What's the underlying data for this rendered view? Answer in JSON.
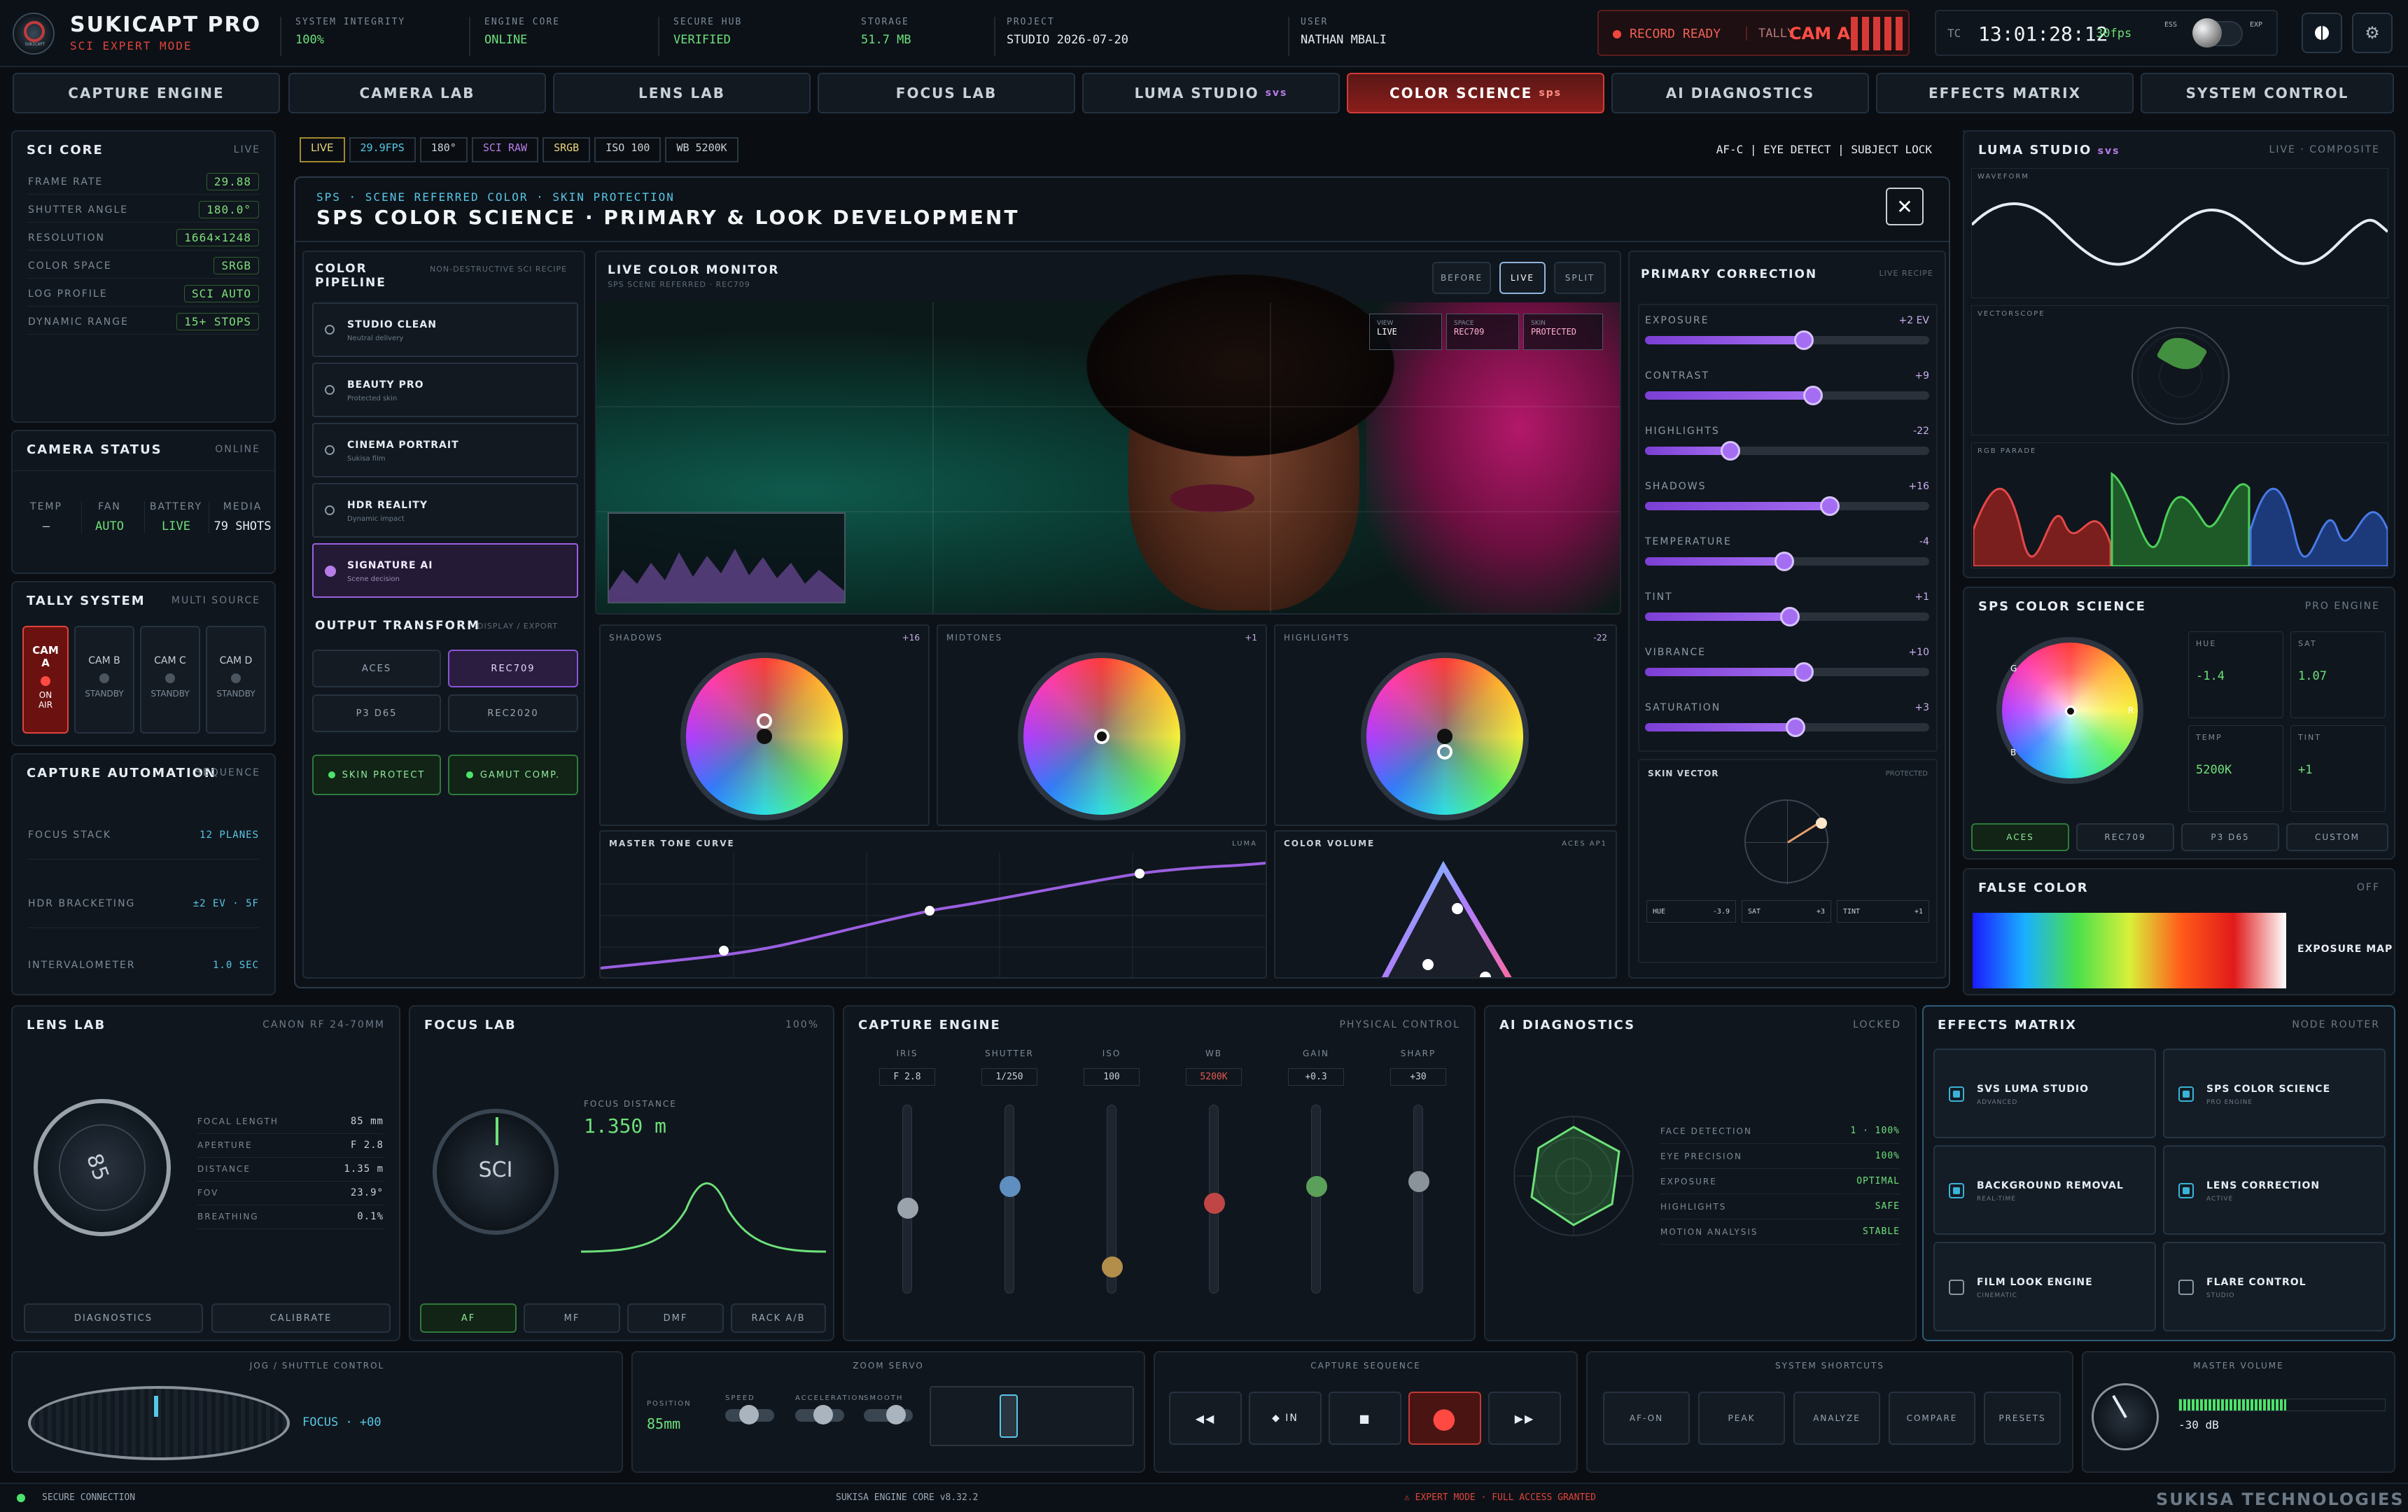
{
  "app": {
    "title": "SUKICAPT PRO",
    "subtitle": "SCI EXPERT MODE",
    "logo_text": "SUKICAPT"
  },
  "status": [
    {
      "label": "SYSTEM INTEGRITY",
      "value": "100%"
    },
    {
      "label": "ENGINE CORE",
      "value": "ONLINE"
    },
    {
      "label": "SECURE HUB",
      "value": "VERIFIED"
    }
  ],
  "storage": {
    "label": "STORAGE",
    "value": "51.7 MB"
  },
  "project": {
    "label": "PROJECT",
    "value": "STUDIO 2026-07-20"
  },
  "user": {
    "label": "USER",
    "value": "NATHAN MBALI"
  },
  "record": {
    "label": "RECORD READY",
    "tally": "TALLY",
    "cam": "CAM A"
  },
  "timecode": {
    "tc": "TC",
    "value": "13:01:28:12",
    "fps": "30fps",
    "ess": "ESS",
    "exp": "EXP"
  },
  "tabs": [
    {
      "label": "CAPTURE ENGINE",
      "suffix": ""
    },
    {
      "label": "CAMERA LAB",
      "suffix": ""
    },
    {
      "label": "LENS LAB",
      "suffix": ""
    },
    {
      "label": "FOCUS LAB",
      "suffix": ""
    },
    {
      "label": "LUMA STUDIO",
      "suffix": "SVS"
    },
    {
      "label": "COLOR SCIENCE",
      "suffix": "SPS"
    },
    {
      "label": "AI DIAGNOSTICS",
      "suffix": ""
    },
    {
      "label": "EFFECTS MATRIX",
      "suffix": ""
    },
    {
      "label": "SYSTEM CONTROL",
      "suffix": ""
    }
  ],
  "sci_core": {
    "title": "SCI CORE",
    "right": "LIVE",
    "rows": [
      {
        "k": "FRAME RATE",
        "v": "29.88"
      },
      {
        "k": "SHUTTER ANGLE",
        "v": "180.0°"
      },
      {
        "k": "RESOLUTION",
        "v": "1664×1248"
      },
      {
        "k": "COLOR SPACE",
        "v": "SRGB"
      },
      {
        "k": "LOG PROFILE",
        "v": "SCI AUTO"
      },
      {
        "k": "DYNAMIC RANGE",
        "v": "15+ STOPS"
      }
    ]
  },
  "camera_status": {
    "title": "CAMERA STATUS",
    "right": "ONLINE",
    "items": [
      {
        "k": "TEMP",
        "v": "–"
      },
      {
        "k": "FAN",
        "v": "AUTO"
      },
      {
        "k": "BATTERY",
        "v": "LIVE"
      },
      {
        "k": "MEDIA",
        "v": "79 SHOTS"
      }
    ]
  },
  "tally": {
    "title": "TALLY SYSTEM",
    "right": "MULTI SOURCE",
    "cams": [
      {
        "name": "CAM A",
        "state": "ON AIR"
      },
      {
        "name": "CAM B",
        "state": "STANDBY"
      },
      {
        "name": "CAM C",
        "state": "STANDBY"
      },
      {
        "name": "CAM D",
        "state": "STANDBY"
      }
    ]
  },
  "automation": {
    "title": "CAPTURE AUTOMATION",
    "right": "SEQUENCE",
    "rows": [
      {
        "k": "FOCUS STACK",
        "v": "12 PLANES"
      },
      {
        "k": "HDR BRACKETING",
        "v": "±2 EV · 5F"
      },
      {
        "k": "INTERVALOMETER",
        "v": "1.0 SEC"
      }
    ]
  },
  "chips": [
    "LIVE",
    "29.9FPS",
    "180°",
    "SCI RAW",
    "SRGB",
    "ISO 100",
    "WB 5200K"
  ],
  "af_status": "AF-C | EYE DETECT | SUBJECT LOCK",
  "modal": {
    "breadcrumb": "SPS · SCENE REFERRED COLOR · SKIN PROTECTION",
    "title": "SPS COLOR SCIENCE · PRIMARY & LOOK DEVELOPMENT"
  },
  "pipeline": {
    "title": "COLOR PIPELINE",
    "right": "NON-DESTRUCTIVE SCI RECIPE",
    "items": [
      {
        "name": "STUDIO CLEAN",
        "sub": "Neutral delivery"
      },
      {
        "name": "BEAUTY PRO",
        "sub": "Protected skin"
      },
      {
        "name": "CINEMA PORTRAIT",
        "sub": "Sukisa film"
      },
      {
        "name": "HDR REALITY",
        "sub": "Dynamic impact"
      },
      {
        "name": "SIGNATURE AI",
        "sub": "Scene decision"
      }
    ]
  },
  "output": {
    "title": "OUTPUT TRANSFORM",
    "right": "DISPLAY / EXPORT",
    "options": [
      "ACES",
      "REC709",
      "P3 D65",
      "REC2020"
    ],
    "toggles": [
      "SKIN PROTECT",
      "GAMUT COMP."
    ]
  },
  "monitor": {
    "title": "LIVE COLOR MONITOR",
    "sub": "SPS SCENE REFERRED · REC709",
    "buttons": [
      "BEFORE",
      "LIVE",
      "SPLIT"
    ],
    "overlay": [
      {
        "k": "VIEW",
        "v": "LIVE"
      },
      {
        "k": "SPACE",
        "v": "REC709"
      },
      {
        "k": "SKIN",
        "v": "PROTECTED"
      }
    ]
  },
  "wheels": [
    {
      "name": "SHADOWS",
      "val": "+16"
    },
    {
      "name": "MIDTONES",
      "val": "+1"
    },
    {
      "name": "HIGHLIGHTS",
      "val": "-22"
    }
  ],
  "tone_curve": {
    "title": "MASTER TONE CURVE",
    "right": "LUMA"
  },
  "color_volume": {
    "title": "COLOR VOLUME",
    "right": "ACES AP1"
  },
  "primary": {
    "title": "PRIMARY CORRECTION",
    "right": "LIVE RECIPE",
    "sliders": [
      {
        "name": "EXPOSURE",
        "val": "+2 EV",
        "pct": 0.56
      },
      {
        "name": "CONTRAST",
        "val": "+9",
        "pct": 0.59
      },
      {
        "name": "HIGHLIGHTS",
        "val": "-22",
        "pct": 0.3
      },
      {
        "name": "SHADOWS",
        "val": "+16",
        "pct": 0.65
      },
      {
        "name": "TEMPERATURE",
        "val": "-4",
        "pct": 0.49
      },
      {
        "name": "TINT",
        "val": "+1",
        "pct": 0.51
      },
      {
        "name": "VIBRANCE",
        "val": "+10",
        "pct": 0.56
      },
      {
        "name": "SATURATION",
        "val": "+3",
        "pct": 0.53
      }
    ]
  },
  "skin_vector": {
    "title": "SKIN VECTOR",
    "right": "PROTECTED",
    "readouts": [
      {
        "k": "HUE",
        "v": "-3.9"
      },
      {
        "k": "SAT",
        "v": "+3"
      },
      {
        "k": "TINT",
        "v": "+1"
      }
    ]
  },
  "luma_studio": {
    "title": "LUMA STUDIO",
    "suffix": "SVS",
    "right": "LIVE · COMPOSITE",
    "scopes": [
      "WAVEFORM",
      "VECTORSCOPE",
      "RGB PARADE"
    ]
  },
  "sps": {
    "title": "SPS COLOR SCIENCE",
    "right": "PRO ENGINE",
    "stats": [
      {
        "k": "HUE",
        "v": "-1.4"
      },
      {
        "k": "SAT",
        "v": "1.07"
      },
      {
        "k": "TEMP",
        "v": "5200K"
      },
      {
        "k": "TINT",
        "v": "+1"
      }
    ],
    "buttons": [
      "ACES",
      "REC709",
      "P3 D65",
      "CUSTOM"
    ],
    "wheel_labels": [
      "G",
      "R",
      "B"
    ]
  },
  "false_color": {
    "title": "FALSE COLOR",
    "right": "OFF",
    "map": "EXPOSURE MAP"
  },
  "lens_lab": {
    "title": "LENS LAB",
    "right": "CANON RF 24-70MM",
    "dial": "85",
    "rows": [
      {
        "k": "FOCAL LENGTH",
        "v": "85 mm"
      },
      {
        "k": "APERTURE",
        "v": "F 2.8"
      },
      {
        "k": "DISTANCE",
        "v": "1.35 m"
      },
      {
        "k": "FOV",
        "v": "23.9°"
      },
      {
        "k": "BREATHING",
        "v": "0.1%"
      }
    ],
    "buttons": [
      "DIAGNOSTICS",
      "CALIBRATE"
    ]
  },
  "focus_lab": {
    "title": "FOCUS LAB",
    "right": "100%",
    "dial": "SCI",
    "dist_label": "FOCUS DISTANCE",
    "dist": "1.350 m",
    "buttons": [
      "AF",
      "MF",
      "DMF",
      "RACK A/B"
    ]
  },
  "capture_engine": {
    "title": "CAPTURE ENGINE",
    "right": "PHYSICAL CONTROL",
    "faders": [
      {
        "name": "IRIS",
        "val": "F 2.8",
        "color": "#9aa3ac",
        "pos": 0.55
      },
      {
        "name": "SHUTTER",
        "val": "1/250",
        "color": "#5f8fc0",
        "pos": 0.42
      },
      {
        "name": "ISO",
        "val": "100",
        "color": "#b38d4a",
        "pos": 0.9
      },
      {
        "name": "WB",
        "val": "5200K",
        "color": "#c04646",
        "pos": 0.52
      },
      {
        "name": "GAIN",
        "val": "+0.3",
        "color": "#5ba05a",
        "pos": 0.42
      },
      {
        "name": "SHARP",
        "val": "+30",
        "color": "#8a929a",
        "pos": 0.39
      }
    ]
  },
  "ai_diag": {
    "title": "AI DIAGNOSTICS",
    "right": "LOCKED",
    "rows": [
      {
        "k": "FACE DETECTION",
        "v": "1 · 100%"
      },
      {
        "k": "EYE PRECISION",
        "v": "100%"
      },
      {
        "k": "EXPOSURE",
        "v": "OPTIMAL"
      },
      {
        "k": "HIGHLIGHTS",
        "v": "SAFE"
      },
      {
        "k": "MOTION ANALYSIS",
        "v": "STABLE"
      }
    ]
  },
  "effects": {
    "title": "EFFECTS MATRIX",
    "right": "NODE ROUTER",
    "items": [
      {
        "name": "SVS LUMA STUDIO",
        "sub": "ADVANCED",
        "on": true
      },
      {
        "name": "SPS COLOR SCIENCE",
        "sub": "PRO ENGINE",
        "on": true
      },
      {
        "name": "BACKGROUND REMOVAL",
        "sub": "REAL-TIME",
        "on": true
      },
      {
        "name": "LENS CORRECTION",
        "sub": "ACTIVE",
        "on": true
      },
      {
        "name": "FILM LOOK ENGINE",
        "sub": "CINEMATIC",
        "on": false
      },
      {
        "name": "FLARE CONTROL",
        "sub": "STUDIO",
        "on": false
      }
    ]
  },
  "jog": {
    "title": "JOG / SHUTTLE CONTROL",
    "focus": "FOCUS · +00"
  },
  "zoom": {
    "title": "ZOOM SERVO",
    "pos_label": "POSITION",
    "pos": "85mm",
    "toggles": [
      "SPEED",
      "ACCELERATION",
      "SMOOTH"
    ]
  },
  "capture_seq": {
    "title": "CAPTURE SEQUENCE",
    "buttons": [
      "◀◀",
      "◆ IN",
      "■",
      "●",
      "▶▶"
    ]
  },
  "shortcuts": {
    "title": "SYSTEM SHORTCUTS",
    "buttons": [
      "AF-ON",
      "PEAK",
      "ANALYZE",
      "COMPARE",
      "PRESETS"
    ]
  },
  "master_volume": {
    "title": "MASTER VOLUME",
    "value": "-30 dB",
    "level": 0.52
  },
  "footer": {
    "secure": "SECURE CONNECTION",
    "engine": "SUKISA ENGINE CORE v8.32.2",
    "expert": "⚠ EXPERT MODE · FULL ACCESS GRANTED",
    "brand": "SUKISA TECHNOLOGIES"
  },
  "colors": {
    "accent": "#b77ce8",
    "green": "#6de07a",
    "red": "#f0473e",
    "cyan": "#58c6e6",
    "bg": "#0a0e13"
  }
}
